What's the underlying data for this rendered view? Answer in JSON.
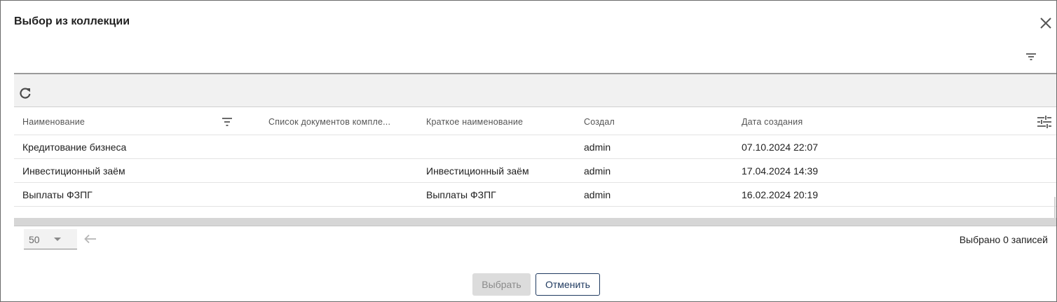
{
  "dialog": {
    "title": "Выбор из коллекции"
  },
  "icons": {
    "close": "close-icon",
    "top_filter": "filter-icon",
    "refresh": "refresh-icon",
    "column_filter": "filter-icon",
    "column_settings": "tune-icon",
    "prev_page": "arrow-left-icon",
    "dropdown": "caret-down-icon"
  },
  "table": {
    "columns": [
      "Наименование",
      "Список документов компле...",
      "Краткое наименование",
      "Создал",
      "Дата создания"
    ],
    "rows": [
      [
        "Кредитование бизнеса",
        "",
        "",
        "admin",
        "07.10.2024 22:07"
      ],
      [
        "Инвестиционный заём",
        "",
        "Инвестиционный заём",
        "admin",
        "17.04.2024 14:39"
      ],
      [
        "Выплаты ФЗПГ",
        "",
        "Выплаты ФЗПГ",
        "admin",
        "16.02.2024 20:19"
      ]
    ]
  },
  "footer": {
    "page_size": "50",
    "selected_text": "Выбрано 0 записей"
  },
  "buttons": {
    "select": "Выбрать",
    "cancel": "Отменить"
  },
  "colors": {
    "cancel_accent": "#1f3a60",
    "disabled_bg": "#dcdcdc",
    "toolbar_bg": "#f1f1f1"
  }
}
